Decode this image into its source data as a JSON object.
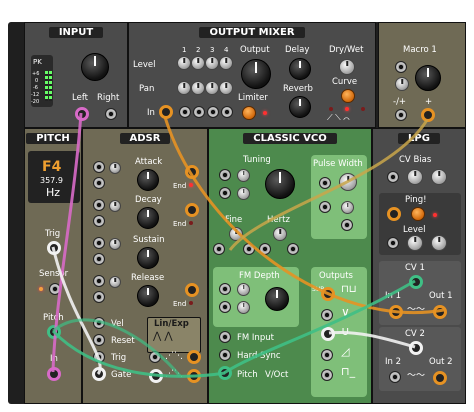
{
  "modules": {
    "input": {
      "title": "INPUT",
      "pk": "PK",
      "db_marks": [
        "+6",
        "0",
        "-6",
        "-12",
        "-20"
      ],
      "left": "Left",
      "right": "Right"
    },
    "output_mixer": {
      "title": "OUTPUT MIXER",
      "channels": [
        "1",
        "2",
        "3",
        "4"
      ],
      "level": "Level",
      "pan": "Pan",
      "in": "In",
      "output": "Output",
      "limiter": "Limiter",
      "delay": "Delay",
      "reverb": "Reverb",
      "drywet": "Dry/Wet",
      "curve": "Curve"
    },
    "macro": {
      "title": "Macro 1",
      "minusplus": "-/+",
      "plus": "+"
    },
    "pitch": {
      "title": "PITCH",
      "note": "F4",
      "freq": "357.9",
      "unit": "Hz",
      "trig": "Trig",
      "sensor": "Sensor",
      "pitch": "Pitch",
      "in": "In"
    },
    "adsr": {
      "title": "ADSR",
      "attack": "Attack",
      "decay": "Decay",
      "sustain": "Sustain",
      "release": "Release",
      "end": "End",
      "vel": "Vel",
      "reset": "Reset",
      "trig": "Trig",
      "gate": "Gate",
      "linexp": "Lin/Exp"
    },
    "vco": {
      "title": "CLASSIC VCO",
      "tuning": "Tuning",
      "pulse_width": "Pulse Width",
      "fine": "Fine",
      "hertz": "Hertz",
      "fm_depth": "FM Depth",
      "outputs": "Outputs",
      "sub": "SUB",
      "fm_input": "FM Input",
      "hard_sync": "Hard Sync",
      "pitch": "Pitch",
      "voct": "V/Oct"
    },
    "lpg": {
      "title": "LPG",
      "cv_bias": "CV Bias",
      "ping": "Ping!",
      "level": "Level",
      "cv1": "CV 1",
      "in1": "In 1",
      "out1": "Out 1",
      "cv2": "CV 2",
      "in2": "In 2",
      "out2": "Out 2"
    }
  },
  "colors": {
    "cable_orange": "#e69223",
    "cable_green": "#3fbf85",
    "cable_pink": "#d86ac8",
    "cable_white": "#f2f2f2",
    "cable_tan": "#c9a64a"
  }
}
